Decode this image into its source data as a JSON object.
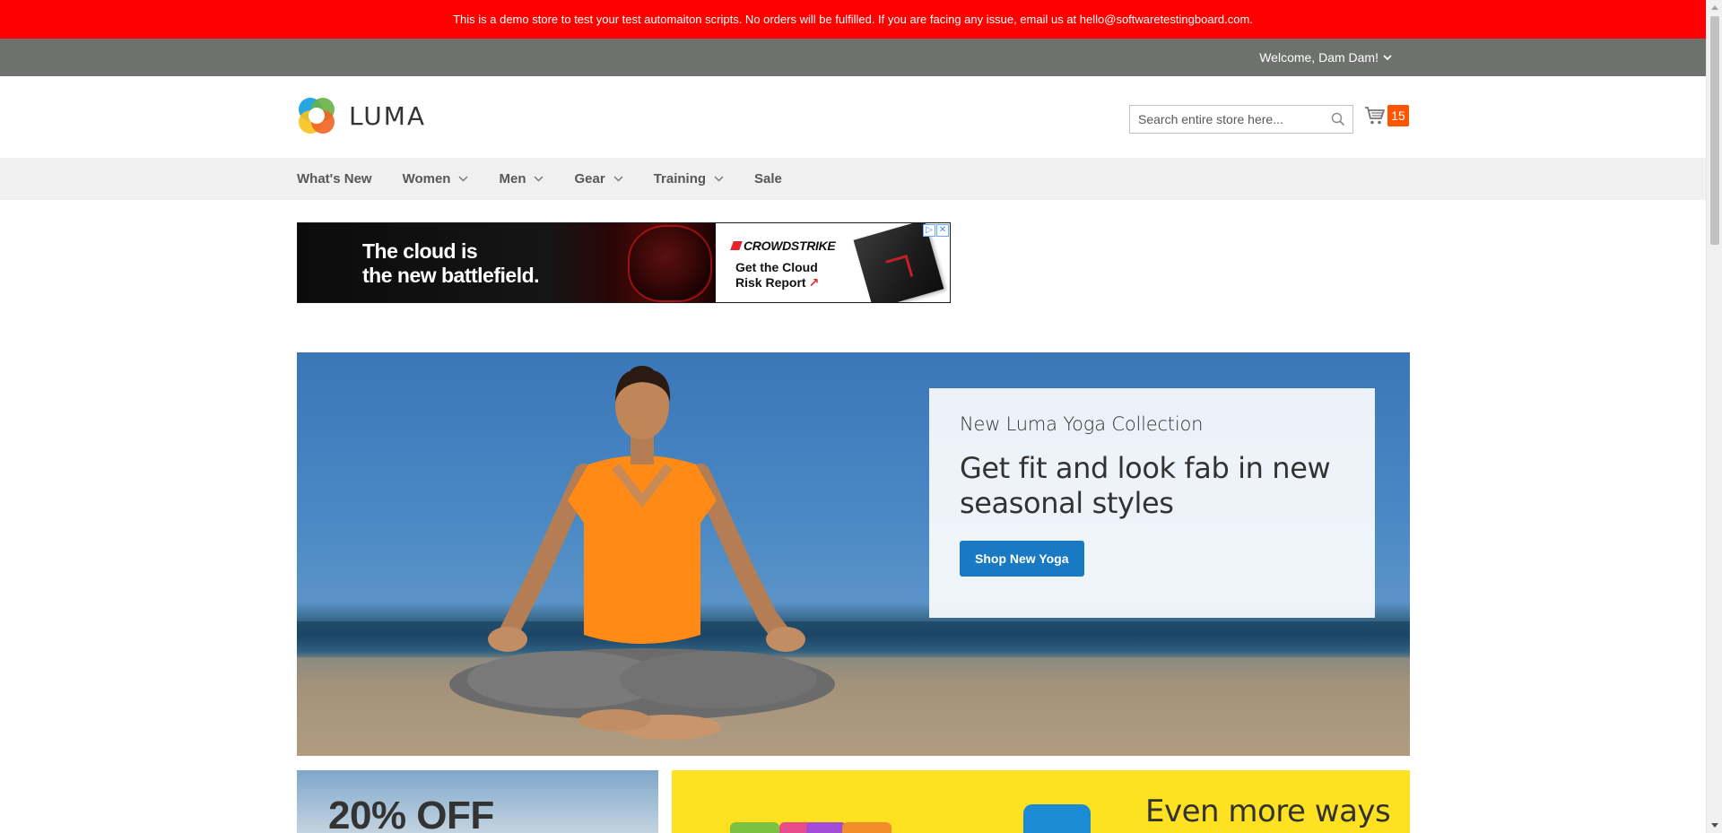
{
  "demo_notice": "This is a demo store to test your test automaiton scripts. No orders will be fulfilled. If you are facing any issue, email us at hello@softwaretestingboard.com.",
  "header": {
    "welcome": "Welcome, Dam Dam!",
    "logo_text": "LUMA",
    "search_placeholder": "Search entire store here...",
    "cart_count": "15"
  },
  "nav": {
    "items": [
      {
        "label": "What's New",
        "has_submenu": false
      },
      {
        "label": "Women",
        "has_submenu": true
      },
      {
        "label": "Men",
        "has_submenu": true
      },
      {
        "label": "Gear",
        "has_submenu": true
      },
      {
        "label": "Training",
        "has_submenu": true
      },
      {
        "label": "Sale",
        "has_submenu": false
      }
    ]
  },
  "ad": {
    "headline_line1": "The cloud is",
    "headline_line2": "the new battlefield.",
    "brand": "CROWDSTRIKE",
    "cta_line1": "Get the Cloud",
    "cta_line2": "Risk Report",
    "cta_arrow": "↗"
  },
  "hero": {
    "subtitle": "New Luma Yoga Collection",
    "title": "Get fit and look fab in new seasonal styles",
    "button": "Shop New Yoga"
  },
  "promos": {
    "left_text": "20% OFF",
    "right_text": "Even more ways"
  },
  "colors": {
    "demo_bar": "#ff0000",
    "panel": "#6e716e",
    "accent_blue": "#1979c3",
    "cart_badge": "#ff5501",
    "nav_bg": "#f0f0f0",
    "promo_yellow": "#fee121"
  },
  "icons": {
    "search": "search-icon",
    "cart": "cart-icon",
    "chevron": "chevron-down-icon",
    "logo": "luma-logo-icon"
  }
}
